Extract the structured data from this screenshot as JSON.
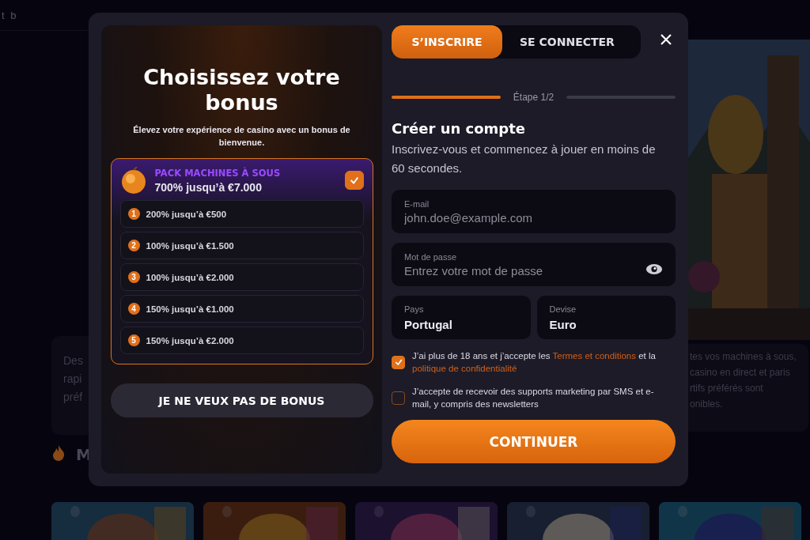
{
  "background": {
    "top_text": "t b",
    "left_card_lines": [
      "Des",
      "rapi",
      "préf"
    ],
    "right_card_lines": [
      "tes vos machines à sous,",
      "casino en direct et paris",
      "rtifs préférés sont",
      "onibles."
    ],
    "side_picture": {
      "kind": "picture"
    },
    "section_title": "M",
    "thumbnails": [
      {
        "kind": "picture"
      },
      {
        "kind": "picture"
      },
      {
        "kind": "picture"
      },
      {
        "kind": "picture"
      },
      {
        "kind": "picture"
      }
    ]
  },
  "bonus": {
    "title": "Choisissez votre bonus",
    "subtitle": "Élevez votre expérience de casino avec un bonus de bienvenue.",
    "pack": {
      "name": "PACK MACHINES À SOUS",
      "amount": "700% jusqu’à €7.000",
      "selected": true
    },
    "steps": [
      {
        "number": "1",
        "text": "200% jusqu’à €500"
      },
      {
        "number": "2",
        "text": "100% jusqu’à €1.500"
      },
      {
        "number": "3",
        "text": "100% jusqu’à €2.000"
      },
      {
        "number": "4",
        "text": "150% jusqu’à €1.000"
      },
      {
        "number": "5",
        "text": "150% jusqu’à €2.000"
      }
    ],
    "decline_button": "JE NE VEUX PAS DE BONUS"
  },
  "tabs": [
    {
      "label": "S’INSCRIRE",
      "selected": true
    },
    {
      "label": "SE CONNECTER",
      "selected": false
    }
  ],
  "progress": {
    "label": "Étape 1/2",
    "segments": [
      {
        "done": true
      },
      {
        "done": false
      }
    ]
  },
  "form": {
    "title": "Créer un compte",
    "intro": "Inscrivez-vous et commencez à jouer en moins de 60 secondes.",
    "fields": [
      {
        "kind": "email",
        "label": "E-mail",
        "placeholder": "john.doe@example.com"
      },
      {
        "kind": "password",
        "label": "Mot de passe",
        "placeholder": "Entrez votre mot de passe"
      },
      {
        "kind": "select",
        "label": "Pays",
        "value": "Portugal"
      },
      {
        "kind": "select",
        "label": "Devise",
        "value": "Euro"
      }
    ],
    "consents": [
      {
        "checked": true,
        "parts": [
          {
            "kind": "plain",
            "text": "J’ai plus de 18 ans et j’accepte les "
          },
          {
            "kind": "link",
            "text": "Termes et conditions"
          },
          {
            "kind": "plain",
            "text": " et la "
          },
          {
            "kind": "link",
            "text": "politique de confidentialité"
          }
        ]
      },
      {
        "checked": false,
        "parts": [
          {
            "kind": "plain",
            "text": "J’accepte de recevoir des supports marketing par SMS et e-mail, y compris des newsletters"
          }
        ]
      }
    ],
    "submit": "CONTINUER"
  }
}
